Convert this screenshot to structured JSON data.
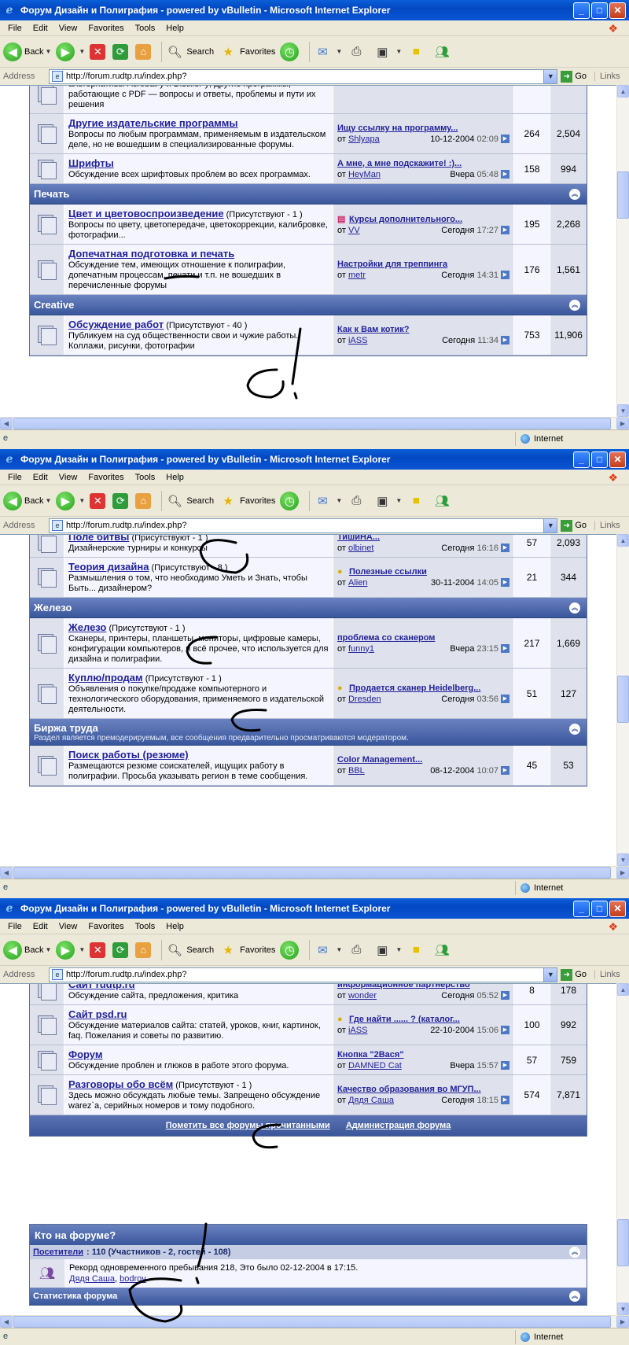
{
  "browser": {
    "title": "Форум Дизайн и Полиграфия - powered by vBulletin - Microsoft Internet Explorer",
    "menu": [
      "File",
      "Edit",
      "View",
      "Favorites",
      "Tools",
      "Help"
    ],
    "toolbar": {
      "back": "Back",
      "search": "Search",
      "favorites": "Favorites"
    },
    "address_label": "Address",
    "url": "http://forum.rudtp.ru/index.php?",
    "go": "Go",
    "links": "Links",
    "status_zone": "Internet"
  },
  "windows": [
    {
      "rows": [
        {
          "type": "forum",
          "title": "",
          "present": "",
          "desc": "альтернативы Acrobat-у и Distiller-у; другие программы, работающие с PDF — вопросы и ответы, проблемы и пути их решения",
          "last_title": "",
          "last_by": "",
          "last_date": "",
          "last_time": "",
          "threads": "",
          "posts": ""
        },
        {
          "type": "forum",
          "title": "Другие издательские программы",
          "present": "",
          "desc": "Вопросы по любым программам, применяемым в издательском деле, но не вошедшим в специализированные форумы.",
          "last_title": "Ищу ссылку на программу...",
          "last_by": "Shlyapa",
          "last_date": "10-12-2004",
          "last_time": "02:09",
          "threads": "264",
          "posts": "2,504"
        },
        {
          "type": "forum",
          "title": "Шрифты",
          "present": "",
          "desc": "Обсуждение всех шрифтовых проблем во всех программах.",
          "last_title": "А мне, а мне подскажите! :)...",
          "last_by": "HeyMan",
          "last_date": "Вчера",
          "last_time": "05:48",
          "threads": "158",
          "posts": "994"
        },
        {
          "type": "cat",
          "title": "Печать",
          "sub": ""
        },
        {
          "type": "forum",
          "title": "Цвет и цветовоспроизведение",
          "present": "(Присутствуют - 1 )",
          "desc": "Вопросы по цвету, цветопередаче, цветокоррекции, калибровке, фотографии...",
          "last_icon": "cmyk",
          "last_title": "Курсы дополнительного...",
          "last_by": "VV",
          "last_date": "Сегодня",
          "last_time": "17:27",
          "threads": "195",
          "posts": "2,268"
        },
        {
          "type": "forum",
          "title": "Допечатная подготовка и печать",
          "present": "",
          "desc": "Обсуждение тем, имеющих отношение к полиграфии, допечатным процессам, печати и т.п. не вошедших в перечисленные форумы",
          "last_title": "Настройки для треппинга",
          "last_by": "metr",
          "last_date": "Сегодня",
          "last_time": "14:31",
          "threads": "176",
          "posts": "1,561"
        },
        {
          "type": "cat",
          "title": "Creative",
          "sub": ""
        },
        {
          "type": "forum",
          "title": "Обсуждение работ",
          "present": "(Присутствуют - 40 )",
          "desc": "Публикуем на суд общественности свои и чужие работы. Коллажи, рисунки, фотографии",
          "last_title": "Как к Вам котик?",
          "last_by": "iASS",
          "last_date": "Сегодня",
          "last_time": "11:34",
          "threads": "753",
          "posts": "11,906"
        }
      ]
    },
    {
      "rows": [
        {
          "type": "forum",
          "title": "Поле битвы",
          "present": "(Присутствуют - 1 )",
          "desc": "Дизайнерские турниры и конкурсы",
          "last_title": "ТишиНА...",
          "last_by": "olbinet",
          "last_date": "Сегодня",
          "last_time": "16:16",
          "threads": "57",
          "posts": "2,093"
        },
        {
          "type": "forum",
          "title": "Теория дизайна",
          "present": "(Присутствуют - 8 )",
          "desc": "Размышления о том, что необходимо Уметь и Знать, чтобы Быть... дизайнером?",
          "last_icon": "bulb",
          "last_title": "Полезные ссылки",
          "last_by": "Alien",
          "last_date": "30-11-2004",
          "last_time": "14:05",
          "threads": "21",
          "posts": "344"
        },
        {
          "type": "cat",
          "title": "Железо",
          "sub": ""
        },
        {
          "type": "forum",
          "title": "Железо",
          "present": "(Присутствуют - 1 )",
          "desc": "Сканеры, принтеры, планшеты, мониторы, цифровые камеры, конфигурации компьютеров, и всё прочее, что используется для дизайна и полиграфии.",
          "last_title": "проблема со сканером",
          "last_by": "funny1",
          "last_date": "Вчера",
          "last_time": "23:15",
          "threads": "217",
          "posts": "1,669"
        },
        {
          "type": "forum",
          "title": "Куплю/продам",
          "present": "(Присутствуют - 1 )",
          "desc": "Объявления о покупке/продаже компьютерного и технологического оборудования, применяемого в издательской деятельности.",
          "last_icon": "bulb",
          "last_title": "Продается сканер Heidelberg...",
          "last_by": "Dresden",
          "last_date": "Сегодня",
          "last_time": "03:56",
          "threads": "51",
          "posts": "127"
        },
        {
          "type": "cat",
          "title": "Биржа труда",
          "sub": "Раздел является премодерируемым, все сообщения предварительно просматриваются модератором."
        },
        {
          "type": "forum",
          "title": "Поиск работы (резюме)",
          "present": "",
          "desc": "Размещаются резюме соискателей, ищущих работу в полиграфии. Просьба указывать регион в теме сообщения.",
          "last_title": "Color Management...",
          "last_by": "BBL",
          "last_date": "08-12-2004",
          "last_time": "10:07",
          "threads": "45",
          "posts": "53"
        }
      ]
    },
    {
      "rows": [
        {
          "type": "forum",
          "title": "Сайт rudtp.ru",
          "present": "",
          "desc": "Обсуждение сайта, предложения, критика",
          "last_title": "информационное партнерство",
          "last_by": "wonder",
          "last_date": "Сегодня",
          "last_time": "05:52",
          "threads": "8",
          "posts": "178"
        },
        {
          "type": "forum",
          "title": "Сайт psd.ru",
          "present": "",
          "desc": "Обсуждение материалов сайта: статей, уроков, книг, картинок, faq. Пожелания и советы по развитию.",
          "last_icon": "bulb",
          "last_title": "Где найти ...... ? (каталог...",
          "last_by": "iASS",
          "last_date": "22-10-2004",
          "last_time": "15:06",
          "threads": "100",
          "posts": "992"
        },
        {
          "type": "forum",
          "title": "Форум",
          "present": "",
          "desc": "Обсуждение проблен и глюков в работе этого форума.",
          "last_title": "Кнопка \"2Вася\"",
          "last_by": "DAMNED Cat",
          "last_date": "Вчера",
          "last_time": "15:57",
          "threads": "57",
          "posts": "759"
        },
        {
          "type": "forum",
          "title": "Разговоры обо всём",
          "present": "(Присутствуют - 1 )",
          "desc": "Здесь можно обсуждать любые темы. Запрещено обсуждение warez`а, серийных номеров и тому подобного.",
          "last_title": "Качество образования во МГУП...",
          "last_by": "Дядя Саша",
          "last_date": "Сегодня",
          "last_time": "18:15",
          "threads": "574",
          "posts": "7,871"
        }
      ],
      "footer": {
        "mark_read": "Пометить все форумы прочитанными",
        "admin": "Администрация форума"
      },
      "who": {
        "title": "Кто на форуме?",
        "visitors_label": "Посетители",
        "visitors_text": ": 110 (Участников - 2, гостей - 108)",
        "record": "Рекорд одновременного пребывания 218, Это было 02-12-2004 в 17:15.",
        "users": [
          "Дядя Саша",
          "bodrov"
        ],
        "stats": "Статистика форума"
      }
    }
  ],
  "labels": {
    "by_prefix": "от"
  }
}
